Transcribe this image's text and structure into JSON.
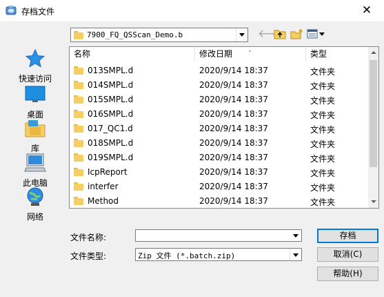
{
  "window": {
    "title": "存档文件",
    "close_glyph": "✕"
  },
  "location": {
    "current": "7900_FQ_QSScan_Demo.b"
  },
  "places": [
    {
      "label": "快速访问",
      "icon": "star-icon"
    },
    {
      "label": "桌面",
      "icon": "desktop-icon"
    },
    {
      "label": "库",
      "icon": "library-icon"
    },
    {
      "label": "此电脑",
      "icon": "computer-icon"
    },
    {
      "label": "网络",
      "icon": "network-icon"
    }
  ],
  "columns": {
    "name": "名称",
    "date": "修改日期",
    "type": "类型"
  },
  "files": [
    {
      "name": "013SMPL.d",
      "date": "2020/9/14 18:37",
      "type": "文件夹"
    },
    {
      "name": "014SMPL.d",
      "date": "2020/9/14 18:37",
      "type": "文件夹"
    },
    {
      "name": "015SMPL.d",
      "date": "2020/9/14 18:37",
      "type": "文件夹"
    },
    {
      "name": "016SMPL.d",
      "date": "2020/9/14 18:37",
      "type": "文件夹"
    },
    {
      "name": "017_QC1.d",
      "date": "2020/9/14 18:37",
      "type": "文件夹"
    },
    {
      "name": "018SMPL.d",
      "date": "2020/9/14 18:37",
      "type": "文件夹"
    },
    {
      "name": "019SMPL.d",
      "date": "2020/9/14 18:37",
      "type": "文件夹"
    },
    {
      "name": "IcpReport",
      "date": "2020/9/14 18:37",
      "type": "文件夹"
    },
    {
      "name": "interfer",
      "date": "2020/9/14 18:37",
      "type": "文件夹"
    },
    {
      "name": "Method",
      "date": "2020/9/14 18:37",
      "type": "文件夹"
    }
  ],
  "form": {
    "filename_label": "文件名称:",
    "filename_value": "",
    "filetype_label": "文件类型:",
    "filetype_value": "Zip 文件 (*.batch.zip)"
  },
  "buttons": {
    "save": "存档",
    "cancel": "取消(C)",
    "help": "帮助(H)"
  },
  "colors": {
    "folder": "#f6cf63",
    "accent": "#0078d7"
  }
}
